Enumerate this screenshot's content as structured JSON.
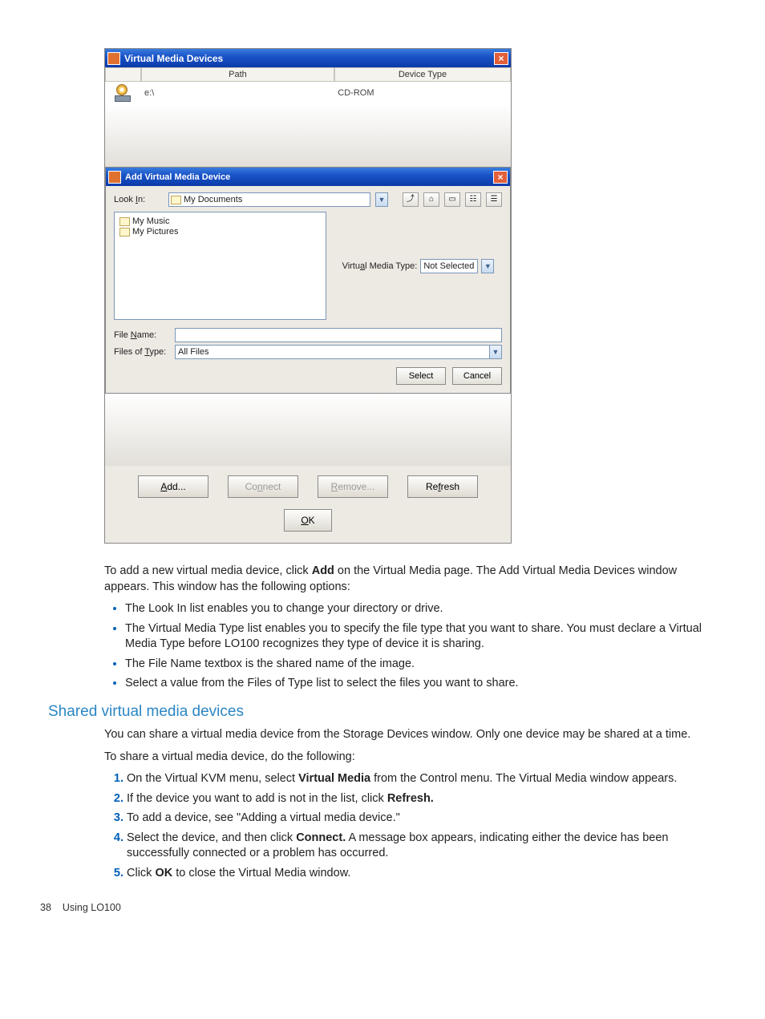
{
  "vmd": {
    "title": "Virtual Media Devices",
    "cols": {
      "path": "Path",
      "type": "Device Type"
    },
    "row": {
      "path": "e:\\",
      "type": "CD-ROM"
    },
    "buttons": {
      "add": "Add...",
      "connect": "Connect",
      "remove": "Remove...",
      "refresh": "Refresh",
      "ok": "OK"
    },
    "mn": {
      "add": "A",
      "connect": "n",
      "remove": "R",
      "refresh": "f",
      "ok": "O"
    }
  },
  "dlg": {
    "title": "Add Virtual Media Device",
    "look_in_lbl": "Look In:",
    "look_in_val": "My Documents",
    "items": [
      "My Music",
      "My Pictures"
    ],
    "vm_type_lbl": "Virtual Media Type:",
    "vm_type_val": "Not Selected",
    "file_name_lbl": "File Name:",
    "file_name_val": "",
    "files_of_type_lbl": "Files of Type:",
    "files_of_type_val": "All Files",
    "select": "Select",
    "cancel": "Cancel",
    "mn": {
      "look": "I",
      "vmtype": "a",
      "fname": "N",
      "ftype": "T"
    }
  },
  "doc": {
    "p1a": "To add a new virtual media device, click ",
    "p1b": "Add",
    "p1c": " on the Virtual Media page. The Add Virtual Media Devices window appears. This window has the following options:",
    "b1": "The Look In list enables you to change your directory or drive.",
    "b2": "The Virtual Media Type list enables you to specify the file type that you want to share. You must declare a Virtual Media Type before LO100 recognizes they type of device it is sharing.",
    "b3": "The File Name textbox is the shared name of the image.",
    "b4": "Select a value from the Files of Type list to select the files you want to share.",
    "h2": "Shared virtual media devices",
    "p2": "You can share a virtual media device from the Storage Devices window. Only one device may be shared at a time.",
    "p3": "To share a virtual media device, do the following:",
    "s1a": "On the Virtual KVM menu, select ",
    "s1b": "Virtual Media",
    "s1c": " from the Control menu. The Virtual Media window appears.",
    "s2a": "If the device you want to add is not in the list, click ",
    "s2b": "Refresh.",
    "s3": "To add a device, see \"Adding a virtual media device.\"",
    "s4a": "Select the device, and then click ",
    "s4b": "Connect.",
    "s4c": " A message box appears, indicating either the device has been successfully connected or a problem has occurred.",
    "s5a": "Click ",
    "s5b": "OK",
    "s5c": " to close the Virtual Media window.",
    "page_num": "38",
    "page_section": "Using LO100"
  }
}
